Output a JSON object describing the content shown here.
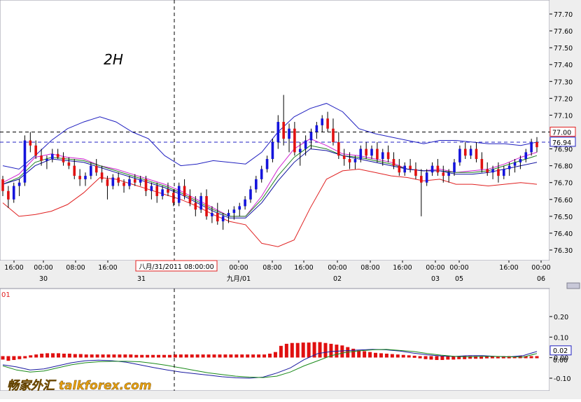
{
  "chart_data": [
    {
      "type": "candlestick",
      "panel": "price",
      "title": "2H",
      "y_ticks": [
        "77.70",
        "77.60",
        "77.50",
        "77.40",
        "77.30",
        "77.20",
        "77.10",
        "77.00",
        "76.90",
        "76.80",
        "76.70",
        "76.60",
        "76.50",
        "76.40",
        "76.30"
      ],
      "ylim": [
        76.25,
        77.75
      ],
      "time_labels": [
        "16:00",
        "00:00",
        "08:00",
        "16:00",
        "00:00",
        "08:00",
        "16:00",
        "00:00",
        "08:00",
        "16:00",
        "00:00",
        "00:00",
        "16:00",
        "00:00"
      ],
      "date_labels": [
        "30",
        "31",
        "九月/01",
        "02",
        "03",
        "05",
        "06"
      ],
      "crosshair_label": "八月/31/2011 08:00:00",
      "levels": [
        {
          "label": "77.00",
          "value": 77.0
        },
        {
          "label": "76.94",
          "value": 76.94
        }
      ],
      "bollinger_upper": [
        76.8,
        76.78,
        76.86,
        76.95,
        77.02,
        77.06,
        77.09,
        77.06,
        77.0,
        76.96,
        76.86,
        76.8,
        76.81,
        76.83,
        76.82,
        76.81,
        76.88,
        77.0,
        77.09,
        77.14,
        77.17,
        77.12,
        77.02,
        76.99,
        76.97,
        76.95,
        76.93,
        76.95,
        76.95,
        76.94,
        76.93,
        76.93,
        76.92,
        76.94
      ],
      "bollinger_lower": [
        76.58,
        76.5,
        76.51,
        76.53,
        76.57,
        76.64,
        76.73,
        76.72,
        76.69,
        76.66,
        76.63,
        76.6,
        76.56,
        76.51,
        76.47,
        76.45,
        76.34,
        76.32,
        76.36,
        76.55,
        76.72,
        76.77,
        76.78,
        76.76,
        76.74,
        76.73,
        76.71,
        76.72,
        76.69,
        76.69,
        76.68,
        76.69,
        76.7,
        76.69
      ],
      "ma_a": [
        76.7,
        76.75,
        76.85,
        76.87,
        76.85,
        76.84,
        76.8,
        76.78,
        76.75,
        76.72,
        76.69,
        76.65,
        76.6,
        76.55,
        76.5,
        76.5,
        76.62,
        76.78,
        76.9,
        76.96,
        76.92,
        76.87,
        76.86,
        76.84,
        76.82,
        76.78,
        76.77,
        76.78,
        76.76,
        76.77,
        76.78,
        76.81,
        76.85,
        76.88
      ],
      "ma_b": [
        76.69,
        76.73,
        76.82,
        76.85,
        76.84,
        76.83,
        76.8,
        76.77,
        76.74,
        76.71,
        76.68,
        76.64,
        76.59,
        76.54,
        76.5,
        76.5,
        76.6,
        76.74,
        76.85,
        76.92,
        76.9,
        76.86,
        76.85,
        76.83,
        76.81,
        76.78,
        76.77,
        76.77,
        76.76,
        76.76,
        76.77,
        76.8,
        76.83,
        76.86
      ],
      "ma_c": [
        76.69,
        76.72,
        76.8,
        76.84,
        76.83,
        76.82,
        76.79,
        76.76,
        76.73,
        76.7,
        76.67,
        76.63,
        76.58,
        76.53,
        76.49,
        76.49,
        76.58,
        76.71,
        76.82,
        76.9,
        76.89,
        76.86,
        76.84,
        76.82,
        76.8,
        76.78,
        76.77,
        76.77,
        76.75,
        76.75,
        76.76,
        76.78,
        76.8,
        76.82
      ],
      "candles": [
        [
          76.72,
          76.74,
          76.62,
          76.65
        ],
        [
          76.65,
          76.68,
          76.55,
          76.6
        ],
        [
          76.6,
          76.7,
          76.58,
          76.68
        ],
        [
          76.68,
          76.72,
          76.62,
          76.7
        ],
        [
          76.7,
          76.98,
          76.68,
          76.95
        ],
        [
          76.95,
          77.0,
          76.88,
          76.92
        ],
        [
          76.92,
          76.95,
          76.84,
          76.86
        ],
        [
          76.86,
          76.9,
          76.8,
          76.83
        ],
        [
          76.83,
          76.86,
          76.78,
          76.84
        ],
        [
          76.84,
          76.9,
          76.82,
          76.87
        ],
        [
          76.87,
          76.9,
          76.84,
          76.85
        ],
        [
          76.85,
          76.88,
          76.8,
          76.82
        ],
        [
          76.82,
          76.85,
          76.78,
          76.8
        ],
        [
          76.8,
          76.84,
          76.72,
          76.74
        ],
        [
          76.74,
          76.78,
          76.68,
          76.72
        ],
        [
          76.72,
          76.76,
          76.68,
          76.74
        ],
        [
          76.74,
          76.82,
          76.72,
          76.8
        ],
        [
          76.8,
          76.84,
          76.74,
          76.76
        ],
        [
          76.76,
          76.8,
          76.7,
          76.72
        ],
        [
          76.72,
          76.74,
          76.6,
          76.68
        ],
        [
          76.68,
          76.75,
          76.66,
          76.73
        ],
        [
          76.73,
          76.76,
          76.68,
          76.7
        ],
        [
          76.7,
          76.72,
          76.64,
          76.68
        ],
        [
          76.68,
          76.74,
          76.66,
          76.72
        ],
        [
          76.72,
          76.75,
          76.68,
          76.7
        ],
        [
          76.7,
          76.74,
          76.68,
          76.72
        ],
        [
          76.72,
          76.74,
          76.62,
          76.65
        ],
        [
          76.65,
          76.7,
          76.6,
          76.68
        ],
        [
          76.68,
          76.7,
          76.58,
          76.62
        ],
        [
          76.62,
          76.68,
          76.6,
          76.66
        ],
        [
          76.66,
          76.7,
          76.62,
          76.64
        ],
        [
          76.64,
          76.66,
          76.56,
          76.58
        ],
        [
          76.58,
          76.7,
          76.56,
          76.68
        ],
        [
          76.68,
          76.72,
          76.6,
          76.62
        ],
        [
          76.62,
          76.66,
          76.56,
          76.58
        ],
        [
          76.58,
          76.62,
          76.5,
          76.54
        ],
        [
          76.54,
          76.64,
          76.52,
          76.62
        ],
        [
          76.62,
          76.66,
          76.48,
          76.5
        ],
        [
          76.5,
          76.56,
          76.46,
          76.52
        ],
        [
          76.52,
          76.58,
          76.45,
          76.47
        ],
        [
          76.47,
          76.52,
          76.42,
          76.5
        ],
        [
          76.5,
          76.54,
          76.46,
          76.52
        ],
        [
          76.52,
          76.56,
          76.48,
          76.54
        ],
        [
          76.54,
          76.58,
          76.5,
          76.56
        ],
        [
          76.56,
          76.62,
          76.54,
          76.6
        ],
        [
          76.6,
          76.68,
          76.58,
          76.66
        ],
        [
          76.66,
          76.74,
          76.64,
          76.72
        ],
        [
          76.72,
          76.8,
          76.7,
          76.78
        ],
        [
          76.78,
          76.86,
          76.76,
          76.84
        ],
        [
          76.84,
          76.96,
          76.82,
          76.94
        ],
        [
          76.94,
          77.1,
          76.9,
          77.06
        ],
        [
          77.06,
          77.22,
          76.92,
          76.96
        ],
        [
          76.96,
          77.05,
          76.88,
          77.02
        ],
        [
          77.02,
          77.06,
          76.86,
          76.88
        ],
        [
          76.88,
          76.94,
          76.8,
          76.9
        ],
        [
          76.9,
          76.98,
          76.86,
          76.95
        ],
        [
          76.95,
          77.02,
          76.9,
          77.0
        ],
        [
          77.0,
          77.06,
          76.96,
          77.04
        ],
        [
          77.04,
          77.1,
          77.0,
          77.08
        ],
        [
          77.08,
          77.12,
          77.0,
          77.02
        ],
        [
          77.02,
          77.08,
          76.92,
          76.94
        ],
        [
          76.94,
          77.0,
          76.84,
          76.86
        ],
        [
          76.86,
          76.9,
          76.8,
          76.84
        ],
        [
          76.84,
          76.88,
          76.78,
          76.82
        ],
        [
          76.82,
          76.86,
          76.78,
          76.84
        ],
        [
          76.84,
          76.92,
          76.82,
          76.9
        ],
        [
          76.9,
          76.94,
          76.84,
          76.86
        ],
        [
          76.86,
          76.92,
          76.84,
          76.9
        ],
        [
          76.9,
          76.94,
          76.82,
          76.84
        ],
        [
          76.84,
          76.9,
          76.8,
          76.88
        ],
        [
          76.88,
          76.92,
          76.82,
          76.84
        ],
        [
          76.84,
          76.88,
          76.78,
          76.8
        ],
        [
          76.8,
          76.84,
          76.74,
          76.76
        ],
        [
          76.76,
          76.82,
          76.74,
          76.8
        ],
        [
          76.8,
          76.84,
          76.76,
          76.78
        ],
        [
          76.78,
          76.82,
          76.72,
          76.74
        ],
        [
          76.74,
          76.78,
          76.5,
          76.7
        ],
        [
          76.7,
          76.78,
          76.68,
          76.76
        ],
        [
          76.76,
          76.82,
          76.74,
          76.8
        ],
        [
          76.8,
          76.84,
          76.74,
          76.76
        ],
        [
          76.76,
          76.8,
          76.7,
          76.74
        ],
        [
          76.74,
          76.78,
          76.7,
          76.76
        ],
        [
          76.76,
          76.84,
          76.74,
          76.82
        ],
        [
          76.82,
          76.92,
          76.8,
          76.9
        ],
        [
          76.9,
          76.94,
          76.84,
          76.86
        ],
        [
          76.86,
          76.92,
          76.84,
          76.9
        ],
        [
          76.9,
          76.94,
          76.82,
          76.84
        ],
        [
          76.84,
          76.88,
          76.76,
          76.78
        ],
        [
          76.78,
          76.82,
          76.74,
          76.76
        ],
        [
          76.76,
          76.8,
          76.72,
          76.78
        ],
        [
          76.78,
          76.82,
          76.7,
          76.74
        ],
        [
          76.74,
          76.8,
          76.72,
          76.78
        ],
        [
          76.78,
          76.82,
          76.74,
          76.8
        ],
        [
          76.8,
          76.84,
          76.76,
          76.82
        ],
        [
          76.82,
          76.86,
          76.78,
          76.84
        ],
        [
          76.84,
          76.9,
          76.82,
          76.88
        ],
        [
          76.88,
          76.96,
          76.86,
          76.94
        ],
        [
          76.94,
          76.97,
          76.88,
          76.91
        ]
      ]
    },
    {
      "type": "macd",
      "panel": "indicator",
      "top_left_label": "01",
      "y_ticks": [
        "0.20",
        "0.10",
        "0.00",
        "-0.10"
      ],
      "ylim": [
        -0.14,
        0.25
      ],
      "values": [
        {
          "label": "0.02",
          "value": 0.02
        },
        {
          "label": "0.00",
          "value": 0.0
        }
      ],
      "histogram": [
        -0.005,
        -0.008,
        -0.006,
        -0.004,
        -0.002,
        0.002,
        0.004,
        0.006,
        0.007,
        0.007,
        0.007,
        0.006,
        0.006,
        0.005,
        0.005,
        0.004,
        0.004,
        0.004,
        0.004,
        0.004,
        0.004,
        0.004,
        0.004,
        0.004,
        0.003,
        0.003,
        0.003,
        0.003,
        0.003,
        0.003,
        0.003,
        0.004,
        0.004,
        0.004,
        0.004,
        0.004,
        0.004,
        0.004,
        0.004,
        0.004,
        0.004,
        0.004,
        0.004,
        0.004,
        0.004,
        0.004,
        0.004,
        0.004,
        0.006,
        0.01,
        0.025,
        0.03,
        0.032,
        0.032,
        0.033,
        0.033,
        0.034,
        0.034,
        0.032,
        0.03,
        0.028,
        0.026,
        0.022,
        0.018,
        0.014,
        0.012,
        0.01,
        0.008,
        0.007,
        0.006,
        0.005,
        0.004,
        0.003,
        0.002,
        0.001,
        -0.002,
        -0.004,
        -0.005,
        -0.006,
        -0.006,
        -0.005,
        -0.005,
        -0.004,
        -0.004,
        -0.003,
        -0.003,
        -0.003,
        -0.002,
        -0.002,
        -0.002,
        -0.002,
        -0.002,
        -0.001,
        -0.001,
        -0.001,
        0.0,
        0.0
      ],
      "signal_line": [
        -0.04,
        -0.06,
        -0.07,
        -0.065,
        -0.05,
        -0.035,
        -0.025,
        -0.02,
        -0.018,
        -0.018,
        -0.02,
        -0.028,
        -0.038,
        -0.05,
        -0.062,
        -0.074,
        -0.082,
        -0.09,
        -0.095,
        -0.097,
        -0.09,
        -0.07,
        -0.04,
        -0.015,
        0.01,
        0.025,
        0.033,
        0.038,
        0.04,
        0.035,
        0.03,
        0.02,
        0.012,
        0.006,
        0.004,
        0.006,
        0.006,
        0.004,
        0.003,
        0.02
      ],
      "macd_line": [
        -0.035,
        -0.045,
        -0.06,
        -0.055,
        -0.04,
        -0.025,
        -0.015,
        -0.012,
        -0.015,
        -0.022,
        -0.035,
        -0.048,
        -0.06,
        -0.07,
        -0.078,
        -0.085,
        -0.093,
        -0.098,
        -0.1,
        -0.095,
        -0.075,
        -0.05,
        -0.01,
        0.02,
        0.03,
        0.034,
        0.037,
        0.04,
        0.038,
        0.032,
        0.022,
        0.014,
        0.008,
        0.006,
        0.01,
        0.01,
        0.006,
        0.004,
        0.01,
        0.03
      ]
    }
  ],
  "watermark": "畅家外汇 talkforex.com",
  "colors": {
    "bull": "#1414dc",
    "bear": "#e01010",
    "bollinger_upper": "#2020c0",
    "bollinger_lower": "#e02020",
    "ma_a": "#d020d0",
    "ma_b": "#208020",
    "ma_c": "#1010a0",
    "macd_line": "#1a1aa0",
    "signal_line": "#1a8a1a",
    "grid_bg": "#ffffff",
    "axis_bg": "#f0f0f0"
  }
}
